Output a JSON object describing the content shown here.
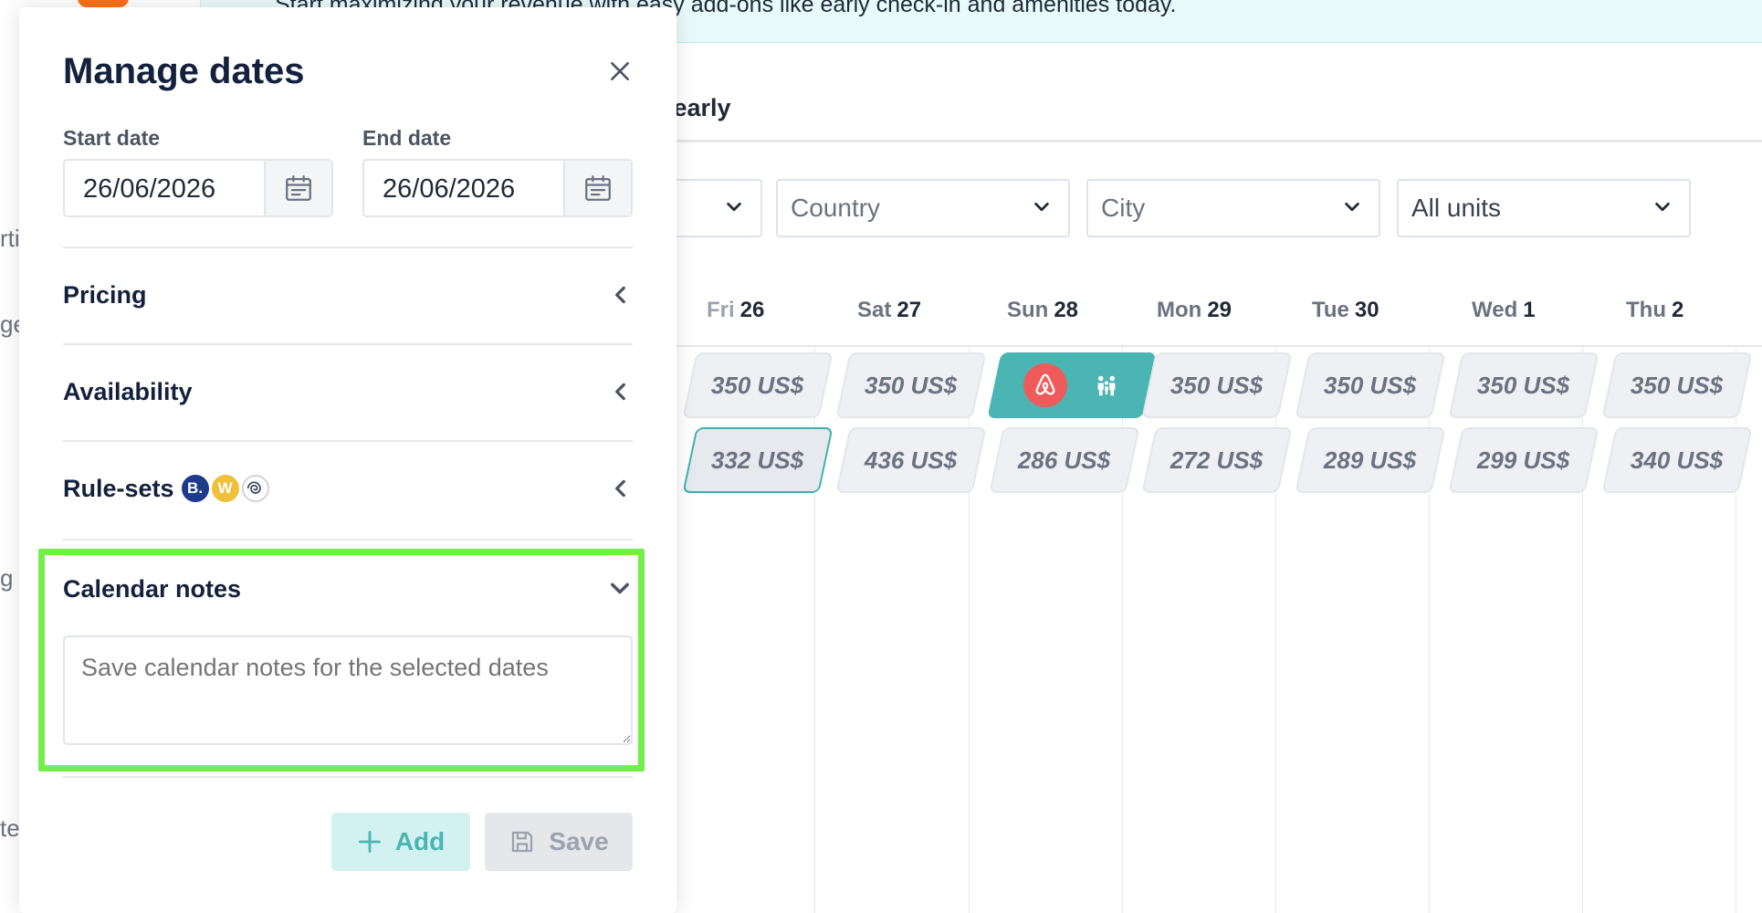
{
  "background": {
    "banner_text": "Start maximizing your revenue with easy add-ons like early check-in and amenities today.",
    "left_nav_fragments": [
      "rti",
      "ge",
      "g",
      "te"
    ],
    "tab_label": "Yearly",
    "filters": {
      "first_value": "",
      "country_placeholder": "Country",
      "city_placeholder": "City",
      "units_value": "All units"
    },
    "calendar": {
      "days": [
        {
          "weekday": "Fri",
          "day": "26"
        },
        {
          "weekday": "Sat",
          "day": "27"
        },
        {
          "weekday": "Sun",
          "day": "28"
        },
        {
          "weekday": "Mon",
          "day": "29"
        },
        {
          "weekday": "Tue",
          "day": "30"
        },
        {
          "weekday": "Wed",
          "day": "1"
        },
        {
          "weekday": "Thu",
          "day": "2"
        }
      ],
      "row1": [
        "350 US$",
        "350 US$",
        "",
        "350 US$",
        "350 US$",
        "350 US$",
        "350 US$"
      ],
      "row2": [
        "332 US$",
        "436 US$",
        "286 US$",
        "272 US$",
        "289 US$",
        "299 US$",
        "340 US$"
      ],
      "booking_icons": [
        "airbnb-icon",
        "guests-icon"
      ]
    }
  },
  "modal": {
    "title": "Manage dates",
    "start_date_label": "Start date",
    "start_date_value": "26/06/2026",
    "end_date_label": "End date",
    "end_date_value": "26/06/2026",
    "sections": {
      "pricing": "Pricing",
      "availability": "Availability",
      "rule_sets": "Rule-sets",
      "calendar_notes": "Calendar notes"
    },
    "rule_set_badges": [
      "B.",
      "W",
      ""
    ],
    "notes_placeholder": "Save calendar notes for the selected dates",
    "add_label": "Add",
    "save_label": "Save"
  },
  "colors": {
    "accent": "#4bb5b3",
    "highlight": "#74ee4a",
    "airbnb": "#ef5b5b"
  }
}
